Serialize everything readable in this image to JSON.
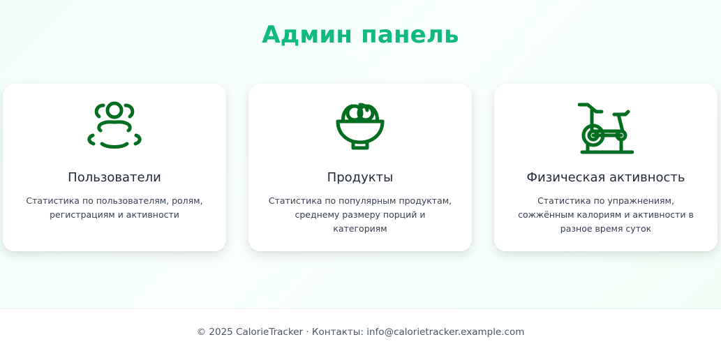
{
  "page": {
    "title": "Админ панель",
    "accent_color": "#10b981",
    "icon_color": "#006d1f"
  },
  "cards": [
    {
      "icon": "users-icon",
      "title": "Пользователи",
      "description": "Статистика по пользователям, ролям, регистрациям и активности"
    },
    {
      "icon": "food-bowl-icon",
      "title": "Продукты",
      "description": "Статистика по популярным продуктам, среднему размеру порций и категориям"
    },
    {
      "icon": "exercise-bike-icon",
      "title": "Физическая активность",
      "description": "Статистика по упражнениям, сожжённым калориям и активности в разное время суток"
    }
  ],
  "footer": {
    "text": "© 2025 CalorieTracker · Контакты: info@calorietracker.example.com"
  }
}
